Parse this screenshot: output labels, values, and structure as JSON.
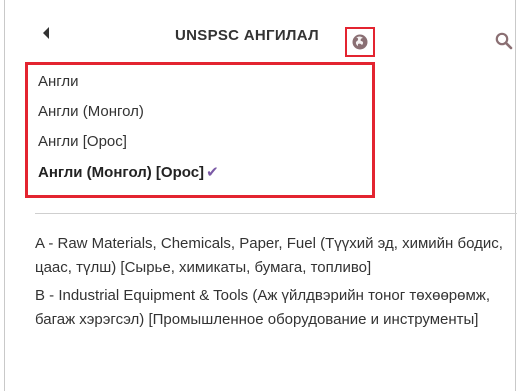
{
  "header": {
    "title": "UNSPSC АНГИЛАЛ"
  },
  "language_menu": {
    "options": [
      {
        "label": "Англи"
      },
      {
        "label": "Англи (Монгол)"
      },
      {
        "label": "Англи [Орос]"
      },
      {
        "label": "Англи (Монгол) [Орос]",
        "selected": true
      }
    ]
  },
  "segments": [
    {
      "text": "A - Raw Materials, Chemicals, Paper, Fuel (Түүхий эд, химийн бодис, цаас, түлш) [Сырье, химикаты, бумага, топливо]"
    },
    {
      "text": "B - Industrial Equipment & Tools (Аж үйлдвэрийн тоног төхөөрөмж, багаж хэрэгсэл) [Промышленное оборудование и инструменты]"
    }
  ],
  "colors": {
    "highlight": "#e32430",
    "accent": "#7b5aa6",
    "icon": "#8a6f73"
  }
}
